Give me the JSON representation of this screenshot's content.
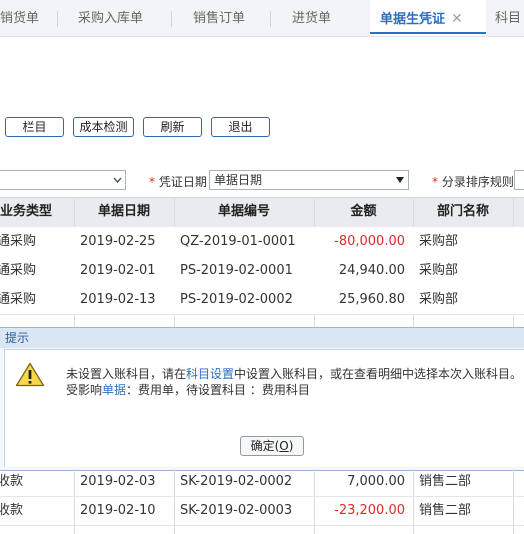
{
  "tabs": [
    {
      "label": "销货单"
    },
    {
      "label": "采购入库单"
    },
    {
      "label": "销售订单"
    },
    {
      "label": "进货单"
    },
    {
      "label": "单据生凭证",
      "active": true,
      "close": "✕"
    },
    {
      "label": "科目"
    }
  ],
  "toolbar": {
    "columns_label": "栏目",
    "cost_check_label": "成本检测",
    "refresh_label": "刷新",
    "exit_label": "退出"
  },
  "filters": {
    "voucher_date_label": "凭证日期",
    "voucher_date_value": "单据日期",
    "sort_rule_label": "分录排序规则",
    "required_mark": "*"
  },
  "table": {
    "headers": {
      "type": "业务类型",
      "date": "单据日期",
      "number": "单据编号",
      "amount": "金额",
      "dept": "部门名称"
    },
    "rows": [
      {
        "type": "通采购",
        "date": "2019-02-25",
        "number": "QZ-2019-01-0001",
        "amount": "-80,000.00",
        "dept": "采购部"
      },
      {
        "type": "通采购",
        "date": "2019-02-01",
        "number": "PS-2019-02-0001",
        "amount": "24,940.00",
        "dept": "采购部"
      },
      {
        "type": "通采购",
        "date": "2019-02-13",
        "number": "PS-2019-02-0002",
        "amount": "25,960.80",
        "dept": "采购部"
      },
      {
        "type": "收款",
        "date": "2019-02-03",
        "number": "SK-2019-02-0002",
        "amount": "7,000.00",
        "dept": "销售二部"
      },
      {
        "type": "收款",
        "date": "2019-02-10",
        "number": "SK-2019-02-0003",
        "amount": "-23,200.00",
        "dept": "销售二部"
      }
    ]
  },
  "dialog": {
    "title": "提示",
    "line1_a": "未设置入账科目，请在",
    "line1_link": "科目设置",
    "line1_b": "中设置入账科目，或在查看明细中选择本次入账科目。",
    "line2_a": "受影响",
    "line2_link": "单据",
    "line2_b": "：费用单，待设置科目 ：费用科目",
    "ok_label": "确定(",
    "ok_key": "O",
    "ok_close": ")"
  },
  "colors": {
    "accent": "#2a6fc4",
    "negative": "#e02a2a"
  }
}
